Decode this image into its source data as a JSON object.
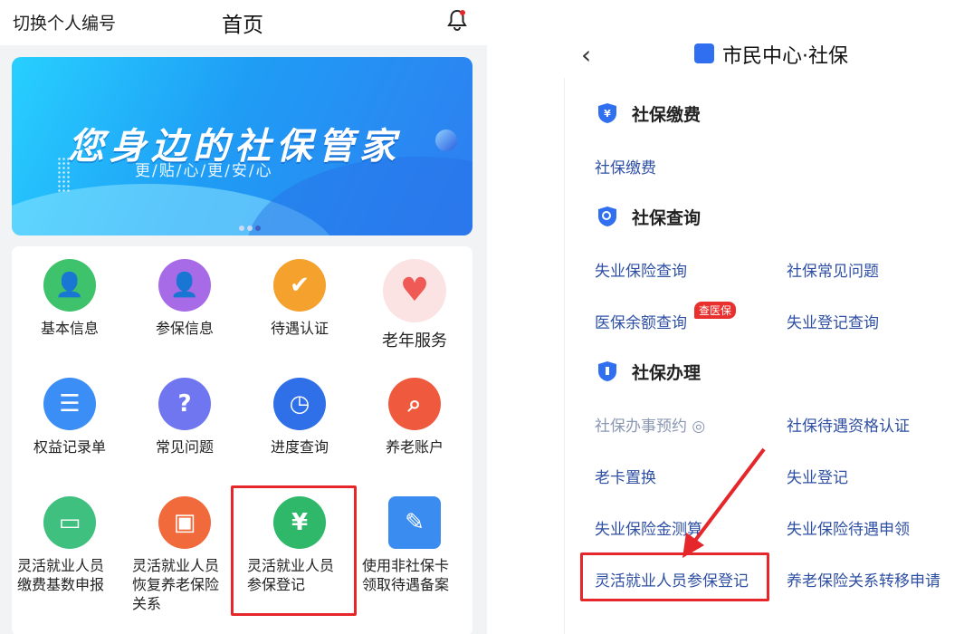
{
  "left": {
    "switch_label": "切换个人编号",
    "title": "首页",
    "banner": {
      "headline": "您身边的社保管家",
      "sub": "更/贴/心/更/安/心"
    },
    "grid": [
      {
        "label": "基本信息",
        "icon": "user-card-icon",
        "color": "#3ec26b"
      },
      {
        "label": "参保信息",
        "icon": "person-icon",
        "color": "#a86be8"
      },
      {
        "label": "待遇认证",
        "icon": "id-check-icon",
        "color": "#f5a12e"
      },
      {
        "label": "老年服务",
        "icon": "elder-heart-icon",
        "color": "#ef5a57"
      },
      {
        "label": "权益记录单",
        "icon": "clipboard-icon",
        "color": "#3b8ef5"
      },
      {
        "label": "常见问题",
        "icon": "question-icon",
        "color": "#6f76f0"
      },
      {
        "label": "进度查询",
        "icon": "progress-icon",
        "color": "#2f6fe8"
      },
      {
        "label": "养老账户",
        "icon": "account-search-icon",
        "color": "#ef5a3f"
      },
      {
        "label": "灵活就业人员缴费基数申报",
        "line1": "灵活就业人员",
        "line2": "缴费基数申报",
        "icon": "card-icon",
        "color": "#3fc07f"
      },
      {
        "label": "灵活就业人员恢复养老保险关系",
        "line1": "灵活就业人员",
        "line2": "恢复养老保险",
        "line3": "关系",
        "icon": "briefcase-icon",
        "color": "#f06a3c"
      },
      {
        "label": "灵活就业人员参保登记",
        "line1": "灵活就业人员",
        "line2": "参保登记",
        "icon": "money-bag-icon",
        "color": "#2fb86a"
      },
      {
        "label": "使用非社保卡领取待遇备案",
        "line1": "使用非社保卡",
        "line2": "领取待遇备案",
        "icon": "card-apply-icon",
        "color": "#3a8cf0"
      }
    ]
  },
  "right": {
    "title": "市民中心·社保",
    "sections": [
      {
        "title": "社保缴费",
        "items": [
          "社保缴费"
        ]
      },
      {
        "title": "社保查询",
        "items": [
          "失业保险查询",
          "社保常见问题",
          "医保余额查询",
          "失业登记查询"
        ],
        "badge": "查医保"
      },
      {
        "title": "社保办理",
        "items": [
          "社保办事预约",
          "社保待遇资格认证",
          "老卡置换",
          "失业登记",
          "失业保险金测算",
          "失业保险待遇申领",
          "灵活就业人员参保登记",
          "养老保险关系转移申请"
        ]
      }
    ]
  },
  "colors": {
    "accent": "#2f6ff0",
    "highlight": "#e5262a",
    "link": "#2e4fa3"
  }
}
